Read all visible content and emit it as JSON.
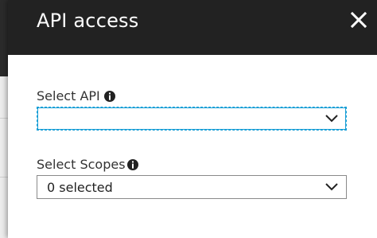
{
  "blade": {
    "title": "API access"
  },
  "fields": {
    "select_api": {
      "label": "Select API",
      "value": ""
    },
    "select_scopes": {
      "label": "Select Scopes",
      "value": "0 selected"
    }
  },
  "colors": {
    "header_bg": "#222222",
    "focus_border": "#1a9fd6",
    "text": "#333333"
  },
  "icons": {
    "close": "close-icon",
    "info": "info-icon",
    "dropdown": "chevron-down-icon"
  }
}
